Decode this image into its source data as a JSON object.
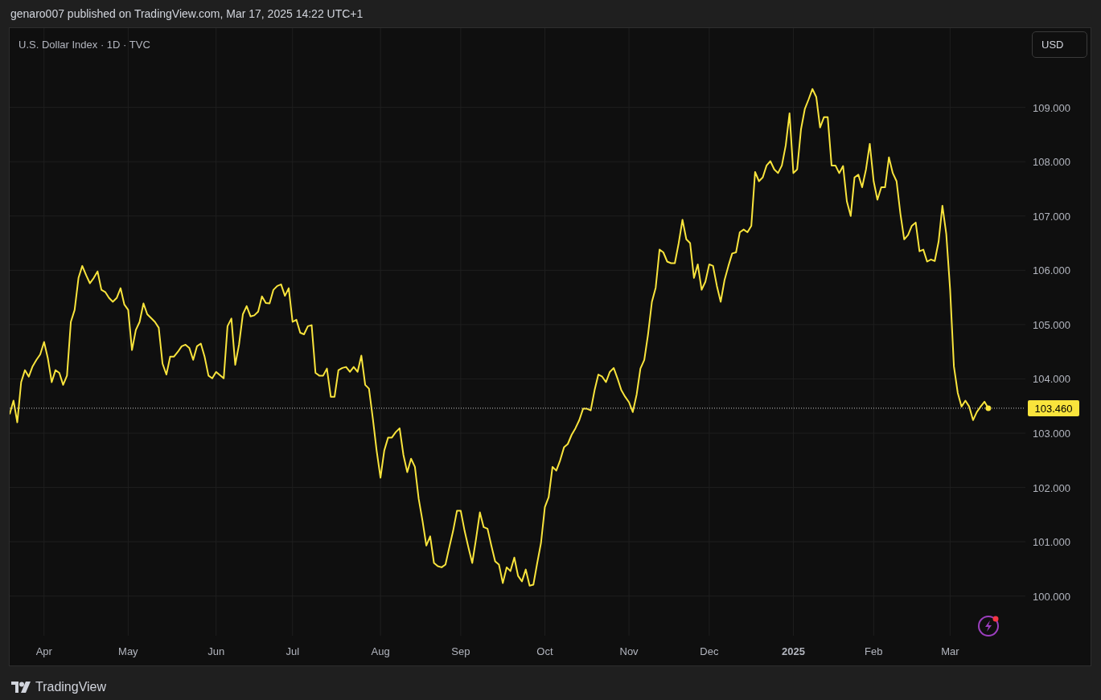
{
  "header": {
    "text": "genaro007 published on TradingView.com, Mar 17, 2025 14:22 UTC+1"
  },
  "chart": {
    "legend_suffix": "· 1D · TVC",
    "currency_button": "USD",
    "chart_data": {
      "type": "line",
      "grid": true,
      "ylim": [
        99.27,
        110.46
      ],
      "categories": [
        null,
        null,
        null,
        null,
        null,
        null,
        null,
        null,
        null,
        "Apr",
        null,
        null,
        null,
        null,
        null,
        null,
        null,
        null,
        null,
        null,
        null,
        null,
        null,
        null,
        null,
        null,
        null,
        null,
        null,
        null,
        null,
        "May",
        null,
        null,
        null,
        null,
        null,
        null,
        null,
        null,
        null,
        null,
        null,
        null,
        null,
        null,
        null,
        null,
        null,
        null,
        null,
        null,
        null,
        null,
        "Jun",
        null,
        null,
        null,
        null,
        null,
        null,
        null,
        null,
        null,
        null,
        null,
        null,
        null,
        null,
        null,
        null,
        null,
        null,
        null,
        "Jul",
        null,
        null,
        null,
        null,
        null,
        null,
        null,
        null,
        null,
        null,
        null,
        null,
        null,
        null,
        null,
        null,
        null,
        null,
        null,
        null,
        null,
        null,
        "Aug",
        null,
        null,
        null,
        null,
        null,
        null,
        null,
        null,
        null,
        null,
        null,
        null,
        null,
        null,
        null,
        null,
        null,
        null,
        null,
        null,
        "Sep",
        null,
        null,
        null,
        null,
        null,
        null,
        null,
        null,
        null,
        null,
        null,
        null,
        null,
        null,
        null,
        null,
        null,
        null,
        null,
        null,
        null,
        "Oct",
        null,
        null,
        null,
        null,
        null,
        null,
        null,
        null,
        null,
        null,
        null,
        null,
        null,
        null,
        null,
        null,
        null,
        null,
        null,
        null,
        null,
        "Nov",
        null,
        null,
        null,
        null,
        null,
        null,
        null,
        null,
        null,
        null,
        null,
        null,
        null,
        null,
        null,
        null,
        null,
        null,
        null,
        null,
        "Dec",
        null,
        null,
        null,
        null,
        null,
        null,
        null,
        null,
        null,
        null,
        null,
        null,
        null,
        null,
        null,
        null,
        null,
        null,
        null,
        null,
        null,
        "2025",
        null,
        null,
        null,
        null,
        null,
        null,
        null,
        null,
        null,
        null,
        null,
        null,
        null,
        null,
        null,
        null,
        null,
        null,
        null,
        null,
        "Feb",
        null,
        null,
        null,
        null,
        null,
        null,
        null,
        null,
        null,
        null,
        null,
        null,
        null,
        null,
        null,
        null,
        null,
        null,
        null,
        "Mar",
        null,
        null,
        null,
        null,
        null,
        null,
        null,
        null,
        null,
        null
      ],
      "series": [
        {
          "name": "U.S. Dollar Index",
          "color": "#f9e43c",
          "values": [
            103.35,
            103.6,
            103.2,
            103.94,
            104.16,
            104.04,
            104.23,
            104.35,
            104.45,
            104.68,
            104.38,
            103.94,
            104.16,
            104.11,
            103.89,
            104.06,
            105.05,
            105.27,
            105.86,
            106.08,
            105.91,
            105.76,
            105.86,
            105.98,
            105.64,
            105.6,
            105.49,
            105.42,
            105.49,
            105.67,
            105.37,
            105.27,
            104.53,
            104.9,
            105.05,
            105.39,
            105.19,
            105.12,
            105.05,
            104.94,
            104.28,
            104.08,
            104.41,
            104.41,
            104.5,
            104.6,
            104.63,
            104.57,
            104.35,
            104.6,
            104.65,
            104.41,
            104.06,
            104.01,
            104.13,
            104.07,
            104.01,
            104.97,
            105.11,
            104.26,
            104.63,
            105.19,
            105.34,
            105.15,
            105.17,
            105.24,
            105.52,
            105.4,
            105.39,
            105.64,
            105.71,
            105.74,
            105.53,
            105.67,
            105.05,
            105.09,
            104.85,
            104.82,
            104.97,
            104.99,
            104.11,
            104.06,
            104.06,
            104.19,
            103.67,
            103.67,
            104.16,
            104.2,
            104.22,
            104.13,
            104.22,
            104.13,
            104.43,
            103.89,
            103.82,
            103.27,
            102.68,
            102.18,
            102.68,
            102.92,
            102.92,
            103.02,
            103.09,
            102.6,
            102.28,
            102.53,
            102.38,
            101.79,
            101.38,
            100.93,
            101.1,
            100.61,
            100.55,
            100.53,
            100.58,
            100.9,
            101.2,
            101.57,
            101.57,
            101.2,
            100.9,
            100.61,
            101.05,
            101.54,
            101.27,
            101.24,
            100.93,
            100.64,
            100.58,
            100.24,
            100.53,
            100.46,
            100.71,
            100.37,
            100.27,
            100.49,
            100.19,
            100.21,
            100.61,
            100.98,
            101.64,
            101.82,
            102.38,
            102.31,
            102.5,
            102.74,
            102.8,
            102.97,
            103.09,
            103.24,
            103.45,
            103.45,
            103.42,
            103.79,
            104.08,
            104.04,
            103.94,
            104.13,
            104.2,
            104.01,
            103.79,
            103.67,
            103.57,
            103.39,
            103.71,
            104.19,
            104.35,
            104.82,
            105.42,
            105.68,
            106.38,
            106.33,
            106.16,
            106.13,
            106.13,
            106.5,
            106.93,
            106.57,
            106.5,
            105.86,
            106.11,
            105.64,
            105.79,
            106.11,
            106.08,
            105.71,
            105.42,
            105.82,
            106.08,
            106.31,
            106.33,
            106.7,
            106.75,
            106.7,
            106.82,
            107.81,
            107.64,
            107.71,
            107.93,
            108.01,
            107.86,
            107.79,
            107.93,
            108.3,
            108.89,
            107.79,
            107.86,
            108.6,
            108.97,
            109.15,
            109.34,
            109.19,
            108.63,
            108.82,
            108.82,
            107.93,
            107.93,
            107.79,
            107.92,
            107.27,
            107.0,
            107.71,
            107.76,
            107.53,
            107.86,
            108.33,
            107.64,
            107.3,
            107.53,
            107.53,
            108.08,
            107.79,
            107.64,
            107.04,
            106.57,
            106.65,
            106.82,
            106.88,
            106.35,
            106.38,
            106.16,
            106.2,
            106.17,
            106.53,
            107.19,
            106.67,
            105.64,
            104.23,
            103.74,
            103.49,
            103.6,
            103.49,
            103.24,
            103.39,
            103.49,
            103.58,
            103.46
          ]
        }
      ],
      "yticks": [
        {
          "value": 100,
          "label": "100.000"
        },
        {
          "value": 101,
          "label": "101.000"
        },
        {
          "value": 102,
          "label": "102.000"
        },
        {
          "value": 103,
          "label": "103.000"
        },
        {
          "value": 104,
          "label": "104.000"
        },
        {
          "value": 105,
          "label": "105.000"
        },
        {
          "value": 106,
          "label": "106.000"
        },
        {
          "value": 107,
          "label": "107.000"
        },
        {
          "value": 108,
          "label": "108.000"
        },
        {
          "value": 109,
          "label": "109.000"
        }
      ],
      "ref_lines": [
        {
          "axis": "y",
          "value": 103.46,
          "label": "103.460"
        }
      ]
    }
  },
  "footer": {
    "brand": "TradingView"
  }
}
